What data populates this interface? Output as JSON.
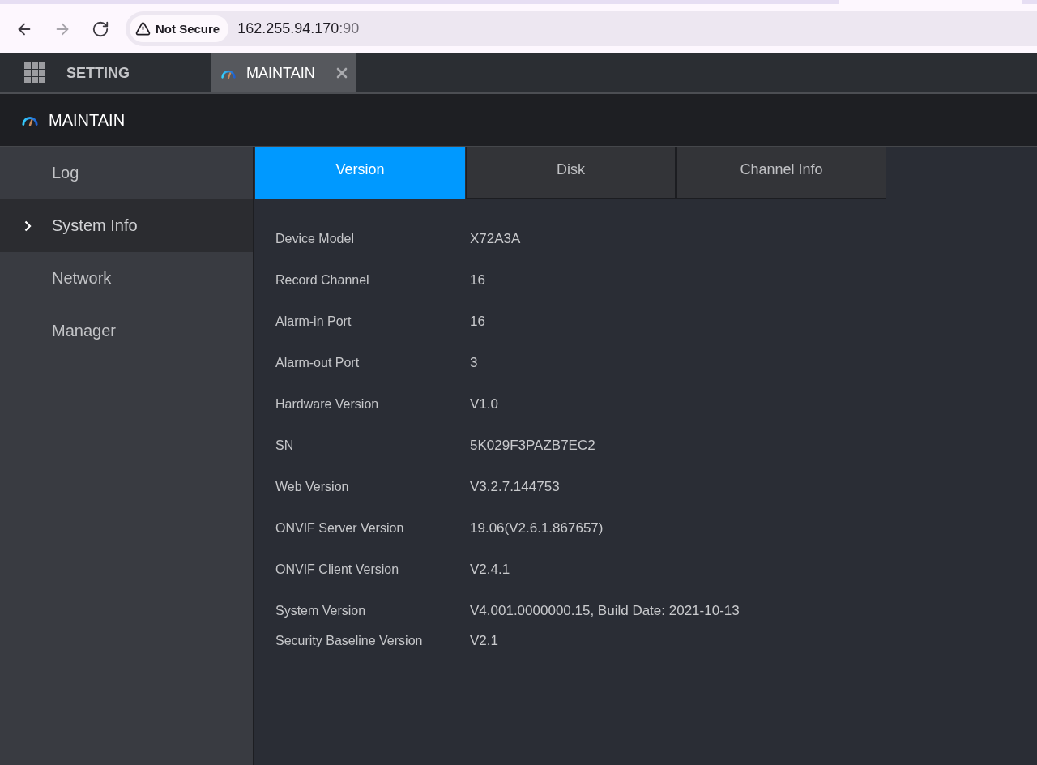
{
  "browser": {
    "nav_buttons": [
      {
        "kind": "back",
        "disabled": false
      },
      {
        "kind": "forward",
        "disabled": true
      },
      {
        "kind": "reload",
        "disabled": false
      }
    ],
    "security_chip": {
      "label": "Not Secure"
    },
    "address": {
      "host": "162.255.94.170",
      "port": ":90"
    }
  },
  "app_tabs": [
    {
      "kind": "menu",
      "label": "SETTING",
      "selected": false,
      "closable": false
    },
    {
      "kind": "page",
      "label": "MAINTAIN",
      "selected": true,
      "closable": true
    }
  ],
  "page_header": {
    "title": "MAINTAIN"
  },
  "sidebar": {
    "items": [
      {
        "label": "Log",
        "selected": false
      },
      {
        "label": "System Info",
        "selected": true
      },
      {
        "label": "Network",
        "selected": false
      },
      {
        "label": "Manager",
        "selected": false
      }
    ]
  },
  "content_tabs": [
    {
      "label": "Version",
      "selected": true
    },
    {
      "label": "Disk",
      "selected": false
    },
    {
      "label": "Channel Info",
      "selected": false
    }
  ],
  "version_info": [
    {
      "label": "Device Model",
      "value": "X72A3A"
    },
    {
      "label": "Record Channel",
      "value": "16"
    },
    {
      "label": "Alarm-in Port",
      "value": "16"
    },
    {
      "label": "Alarm-out Port",
      "value": "3"
    },
    {
      "label": "Hardware Version",
      "value": "V1.0"
    },
    {
      "label": "SN",
      "value": "5K029F3PAZB7EC2"
    },
    {
      "label": "Web Version",
      "value": "V3.2.7.144753"
    },
    {
      "label": "ONVIF Server Version",
      "value": "19.06(V2.6.1.867657)"
    },
    {
      "label": "ONVIF Client Version",
      "value": "V2.4.1"
    },
    {
      "label": "System Version",
      "value": "V4.001.0000000.15, Build Date: 2021-10-13"
    },
    {
      "label": "Security Baseline Version",
      "value": "V2.1"
    }
  ]
}
